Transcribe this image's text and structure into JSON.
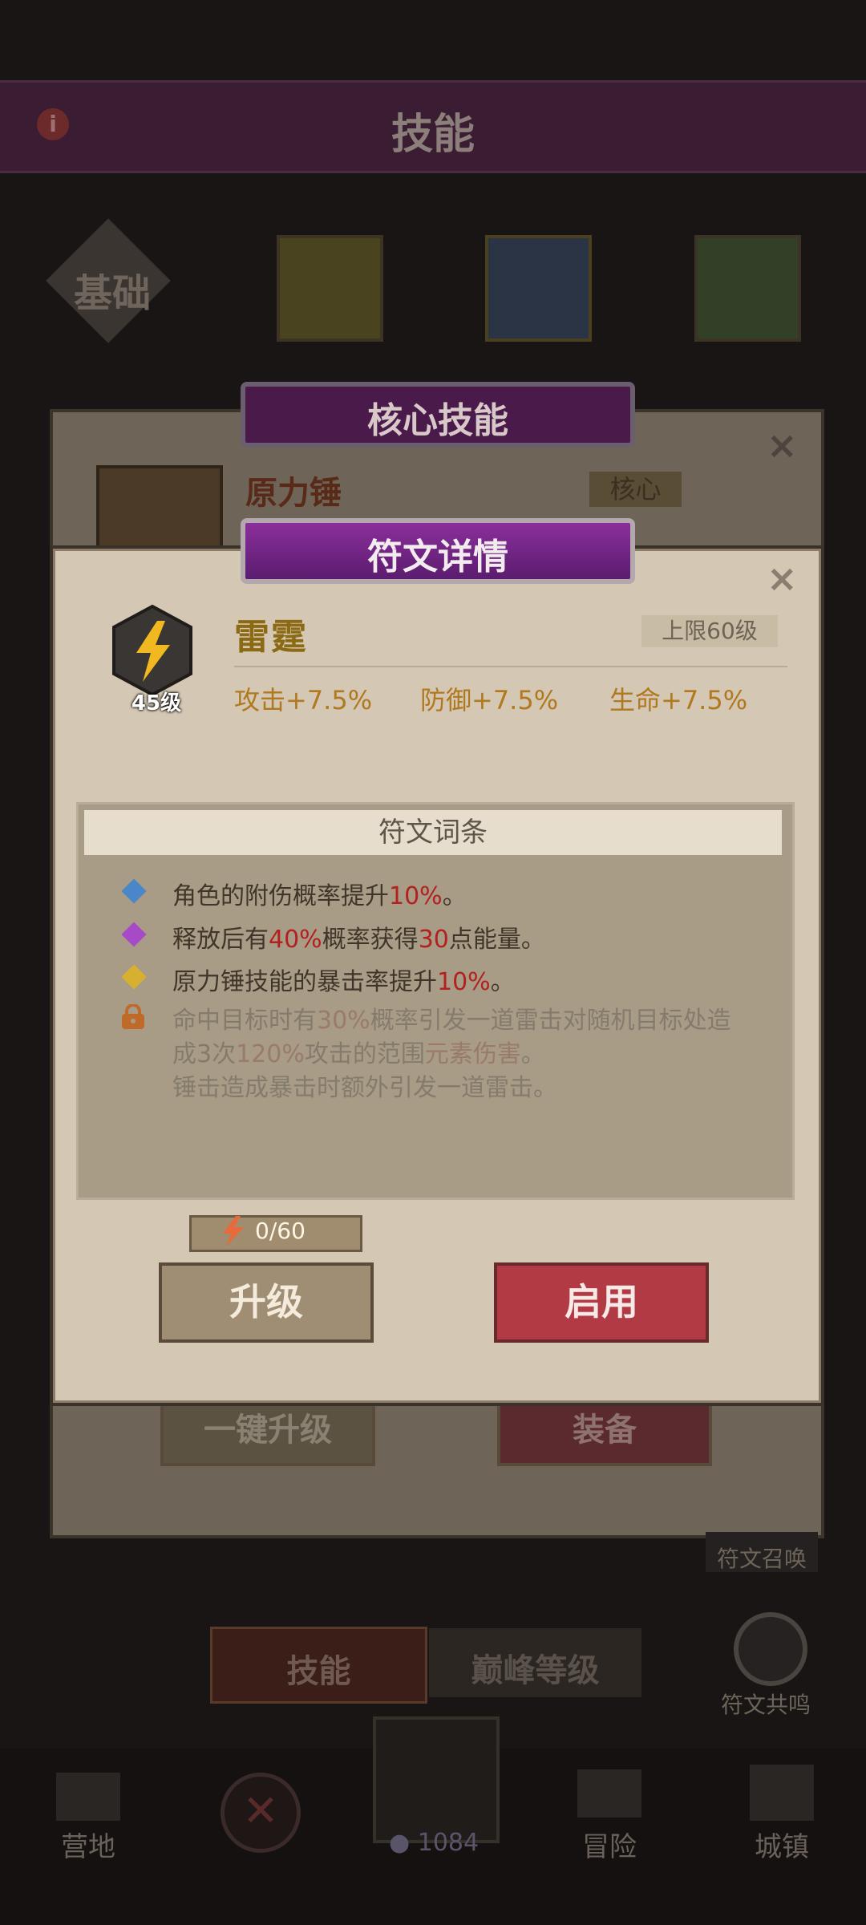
{
  "header": {
    "title": "技能",
    "info": "i"
  },
  "tabs": {
    "basic": "基础"
  },
  "core_banner": "核心技能",
  "core_skill": {
    "name": "原力锤",
    "tag": "核心"
  },
  "background_buttons": {
    "upgrade_all": "一键升级",
    "equip": "装备"
  },
  "side": {
    "rune_summon": "符文召唤",
    "rune_resonance": "符文共鸣"
  },
  "bottom_tabs": {
    "skill": "技能",
    "peak": "巅峰等级"
  },
  "nav": {
    "camp": "营地",
    "adventure": "冒险",
    "town": "城镇",
    "gem_count": "1084"
  },
  "dialog": {
    "title": "符文详情",
    "close": "×",
    "rune": {
      "name": "雷霆",
      "level": "45级",
      "limit": "上限60级"
    },
    "stats": [
      "攻击+7.5%",
      "防御+7.5%",
      "生命+7.5%"
    ],
    "entries_title": "符文词条",
    "entries": {
      "e1": {
        "a": "角色的附伤概率提升",
        "b": "10%",
        "c": "。"
      },
      "e2": {
        "a": "释放后有",
        "b": "40%",
        "c": "概率获得",
        "d": "30",
        "e": "点能量。"
      },
      "e3": {
        "a": "原力锤技能的暴击率提升",
        "b": "10%",
        "c": "。"
      },
      "e4": {
        "a": "命中目标时有",
        "b": "30%",
        "c": "概率引发一道雷击对随机目标处造",
        "d": "成3次",
        "e": "120%",
        "f": "攻击的范围",
        "g": "元素伤害",
        "h": "。",
        "i": "锤击造成暴击时额外引发一道雷击。"
      }
    },
    "progress": "0/60",
    "btn_upgrade": "升级",
    "btn_use": "启用"
  },
  "colors": {
    "accent_red": "#b32020",
    "gold": "#b0781f",
    "purple": "#8a2f9c"
  }
}
